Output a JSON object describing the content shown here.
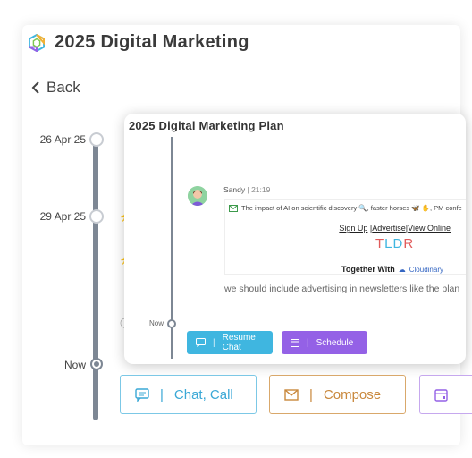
{
  "app": {
    "title": "2025 Digital Marketing"
  },
  "nav": {
    "back_label": "Back"
  },
  "timeline": {
    "dates": [
      "26 Apr 25",
      "29 Apr 25",
      "Now"
    ]
  },
  "popup": {
    "title": "2025 Digital Marketing Plan",
    "now_label": "Now",
    "message": {
      "sender": "Sandy",
      "time": "21:19",
      "email_subject": "The impact of AI on scientific discovery 🔍, faster horses 🦋 ✋, PM confe",
      "email_links": [
        "Sign Up",
        "Advertise",
        "View Online"
      ],
      "email_logo": "TLDR",
      "together_text": "Together With",
      "partner_name": "Cloudinary",
      "body": "we should include advertising in newsletters like the plan"
    },
    "buttons": {
      "resume_chat": "Resume Chat",
      "schedule": "Schedule"
    }
  },
  "actions": {
    "chat_call": "Chat, Call",
    "compose": "Compose"
  },
  "colors": {
    "timeline": "#7d8794",
    "chat_blue": "#3fb6e0",
    "schedule_purple": "#9461e6",
    "compose_orange": "#c9883c"
  },
  "icons": [
    "hexagon-logo-icon",
    "chevron-left-icon",
    "chat-icon",
    "envelope-icon",
    "calendar-icon",
    "mail-icon"
  ]
}
